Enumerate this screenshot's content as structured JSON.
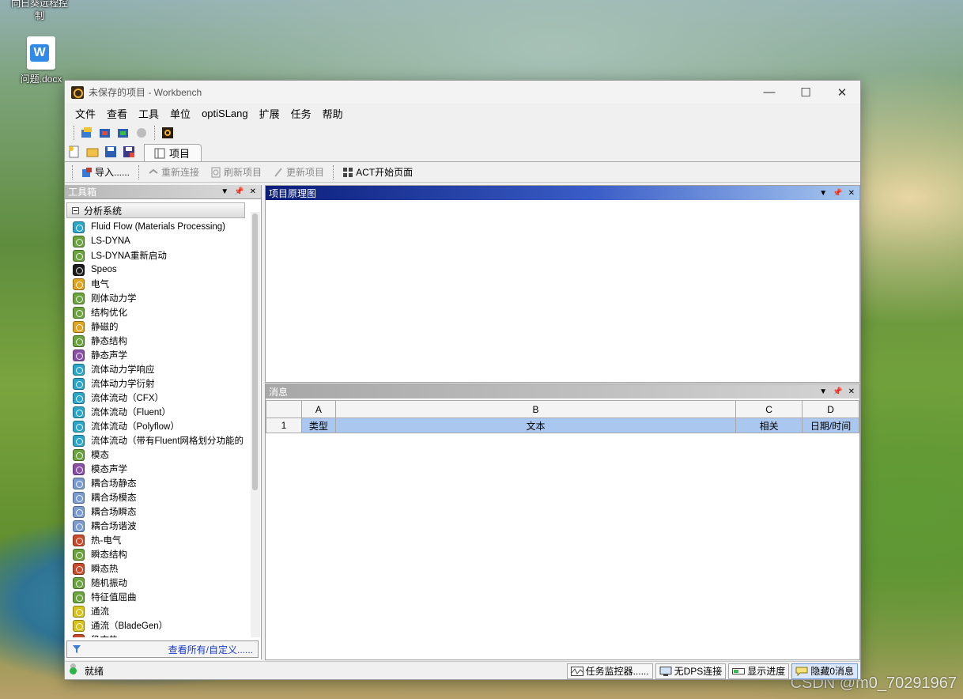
{
  "desktop": {
    "icon1_label": "向日葵远程控制",
    "icon2_label": "问题.docx",
    "watermark": "CSDN @m0_70291967"
  },
  "window": {
    "title": "未保存的项目 - Workbench",
    "controls": [
      "—",
      "☐",
      "✕"
    ]
  },
  "menu": [
    "文件",
    "查看",
    "工具",
    "单位",
    "optiSLang",
    "扩展",
    "任务",
    "帮助"
  ],
  "project_tab": "项目",
  "toolbar2": {
    "import": "导入......",
    "reconnect": "重新连接",
    "refresh": "刷新项目",
    "update": "更新项目",
    "act": "ACT开始页面"
  },
  "toolbox": {
    "title": "工具箱",
    "group": "分析系统",
    "items": [
      {
        "label": "Fluid Flow (Materials Processing)",
        "color": "#2aa6c9"
      },
      {
        "label": "LS-DYNA",
        "color": "#6ba33c"
      },
      {
        "label": "LS-DYNA重新启动",
        "color": "#6ba33c"
      },
      {
        "label": "Speos",
        "color": "#1b1b1b"
      },
      {
        "label": "电气",
        "color": "#e0a51f"
      },
      {
        "label": "刚体动力学",
        "color": "#6ba33c"
      },
      {
        "label": "结构优化",
        "color": "#6ba33c"
      },
      {
        "label": "静磁的",
        "color": "#e0a51f"
      },
      {
        "label": "静态结构",
        "color": "#6ba33c"
      },
      {
        "label": "静态声学",
        "color": "#8a4fa8"
      },
      {
        "label": "流体动力学响应",
        "color": "#2aa6c9"
      },
      {
        "label": "流体动力学衍射",
        "color": "#2aa6c9"
      },
      {
        "label": "流体流动（CFX）",
        "color": "#2aa6c9"
      },
      {
        "label": "流体流动（Fluent）",
        "color": "#2aa6c9"
      },
      {
        "label": "流体流动（Polyflow）",
        "color": "#2aa6c9"
      },
      {
        "label": "流体流动（带有Fluent网格划分功能的",
        "color": "#2aa6c9"
      },
      {
        "label": "模态",
        "color": "#6ba33c"
      },
      {
        "label": "模态声学",
        "color": "#8a4fa8"
      },
      {
        "label": "耦合场静态",
        "color": "#7a9bd2"
      },
      {
        "label": "耦合场模态",
        "color": "#7a9bd2"
      },
      {
        "label": "耦合场瞬态",
        "color": "#7a9bd2"
      },
      {
        "label": "耦合场谐波",
        "color": "#7a9bd2"
      },
      {
        "label": "热-电气",
        "color": "#c94a2a"
      },
      {
        "label": "瞬态结构",
        "color": "#6ba33c"
      },
      {
        "label": "瞬态热",
        "color": "#c94a2a"
      },
      {
        "label": "随机振动",
        "color": "#6ba33c"
      },
      {
        "label": "特征值屈曲",
        "color": "#6ba33c"
      },
      {
        "label": "通流",
        "color": "#d9c21a"
      },
      {
        "label": "通流（BladeGen）",
        "color": "#d9c21a"
      },
      {
        "label": "稳态热",
        "color": "#c94a2a"
      }
    ],
    "footer_link": "查看所有/自定义......"
  },
  "schematic": {
    "title": "项目原理图"
  },
  "messages": {
    "title": "消息",
    "columns": [
      "A",
      "B",
      "C",
      "D"
    ],
    "row_number": "1",
    "row": [
      "类型",
      "文本",
      "相关",
      "日期/时间"
    ]
  },
  "status": {
    "text": "就绪",
    "buttons": [
      "任务监控器......",
      "无DPS连接",
      "显示进度",
      "隐藏0消息"
    ]
  }
}
